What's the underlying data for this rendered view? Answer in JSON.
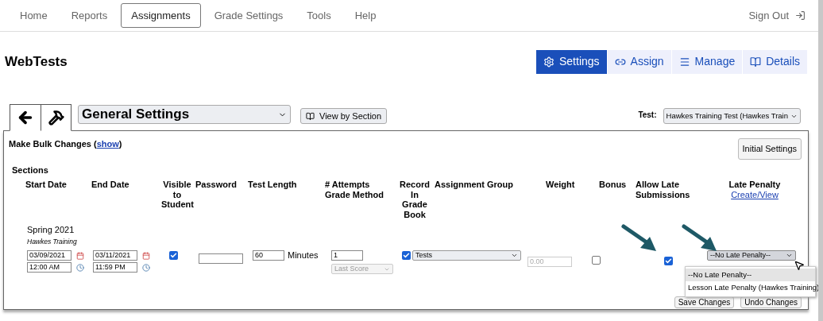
{
  "nav": {
    "items": [
      {
        "label": "Home",
        "selected": false
      },
      {
        "label": "Reports",
        "selected": false
      },
      {
        "label": "Assignments",
        "selected": true
      },
      {
        "label": "Grade Settings",
        "selected": false
      },
      {
        "label": "Tools",
        "selected": false
      },
      {
        "label": "Help",
        "selected": false
      }
    ],
    "sign_out": "Sign Out"
  },
  "title": "WebTests",
  "view_tabs": [
    {
      "kind": "gear",
      "label": "Settings",
      "selected": true
    },
    {
      "kind": "link",
      "label": "Assign",
      "selected": false
    },
    {
      "kind": "lines",
      "label": "Manage",
      "selected": false
    },
    {
      "kind": "book",
      "label": "Details",
      "selected": false
    }
  ],
  "toolbar": {
    "settings_select": "General Settings",
    "view_button": "View by Section",
    "test_label": "Test:",
    "test_select": "Hawkes Training Test (Hawkes Train"
  },
  "bulk": {
    "text": "Make Bulk Changes (",
    "link": "show",
    "after": ")"
  },
  "initial_settings_button": "Initial Settings",
  "sections_label": "Sections",
  "columns": [
    {
      "label": "Start Date"
    },
    {
      "label": "End Date"
    },
    {
      "label": "Visible to Student"
    },
    {
      "label": "Password"
    },
    {
      "label": "Test Length"
    },
    {
      "label": "# Attempts Grade Method"
    },
    {
      "label": "Record In Grade Book"
    },
    {
      "label": "Assignment Group"
    },
    {
      "label": "Weight"
    },
    {
      "label": "Bonus"
    },
    {
      "label": "Allow Late Submissions"
    },
    {
      "label": "Late Penalty",
      "link": "Create/View"
    }
  ],
  "section": {
    "name": "Spring 2021",
    "subtitle": "Hawkes Training",
    "start_date": "03/09/2021",
    "start_time": "12:00 AM",
    "end_date": "03/11/2021",
    "end_time": "11:59 PM",
    "visible": true,
    "test_length": "60",
    "unit": "Minutes",
    "attempts": "1",
    "grade_method": {
      "value": "Last Score",
      "disabled": true
    },
    "record": true,
    "group": "Tests",
    "weight_placeholder": "0.00",
    "bonus": false,
    "allow_late": true,
    "late_penalty": "--No Late Penalty--"
  },
  "late_penalty_menu": [
    {
      "label": "--No Late Penalty--",
      "selected": true
    },
    {
      "label": "Lesson Late Penalty (Hawkes Training)",
      "selected": false
    }
  ],
  "buttons": [
    "Save Changes",
    "Undo Changes"
  ]
}
